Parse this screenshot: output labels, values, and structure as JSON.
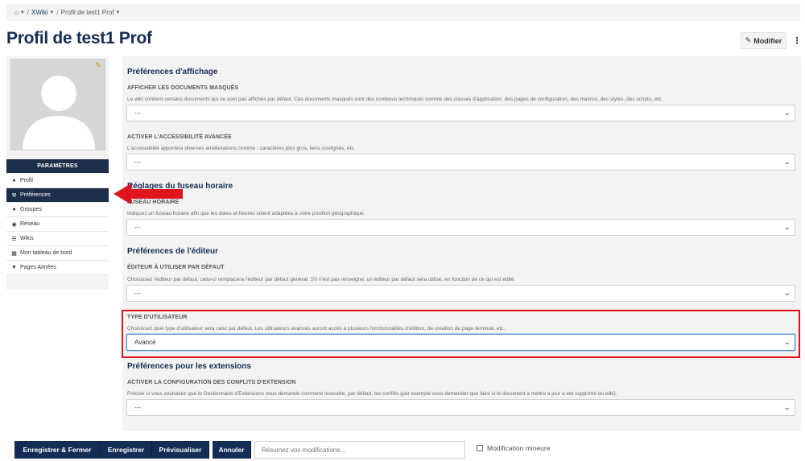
{
  "breadcrumb": {
    "home_icon": "home-icon",
    "items": [
      "XWiki",
      "Profil de test1 Prof"
    ]
  },
  "page": {
    "title": "Profil de test1 Prof",
    "edit_label": "Modifier",
    "more_icon": "more-vertical-icon"
  },
  "sidebar": {
    "settings_header": "PARAMÈTRES",
    "items": [
      {
        "label": "Profil",
        "icon": "user-icon"
      },
      {
        "label": "Préférences",
        "icon": "wrench-icon",
        "active": true
      },
      {
        "label": "Groupes",
        "icon": "users-icon"
      },
      {
        "label": "Réseau",
        "icon": "globe-icon"
      },
      {
        "label": "Wikis",
        "icon": "list-icon"
      },
      {
        "label": "Mon tableau de bord",
        "icon": "grid-icon"
      },
      {
        "label": "Pages Aimées",
        "icon": "heart-icon"
      }
    ]
  },
  "sections": {
    "display": {
      "title": "Préférences d'affichage",
      "hidden_docs": {
        "label": "AFFICHER LES DOCUMENTS MASQUÉS",
        "hint": "Le wiki contient certains documents qui ne sont pas affichés par défaut. Ces documents masqués sont des contenus techniques comme des classes d'application, des pages de configuration, des macros, des styles, des scripts, etc.",
        "value": "---"
      },
      "accessibility": {
        "label": "ACTIVER L'ACCESSIBILITÉ AVANCÉE",
        "hint": "L'accessibilité apportera diverses améliorations comme : caractères plus gros, liens soulignés, etc.",
        "value": "---"
      }
    },
    "timezone": {
      "title": "Réglages du fuseau horaire",
      "field": {
        "label": "FUSEAU HORAIRE",
        "hint": "Indiquez un fuseau horaire afin que les dates et heures soient adaptées à votre position géographique.",
        "value": "---"
      }
    },
    "editor": {
      "title": "Préférences de l'éditeur",
      "default_editor": {
        "label": "ÉDITEUR À UTILISER PAR DÉFAUT",
        "hint": "Choisissez l'éditeur par défaut, celui-ci remplacera l'éditeur par défaut général. S'il n'est pas renseigné, un éditeur par défaut sera utilisé, en fonction de ce qui est édité.",
        "value": "---"
      },
      "user_type": {
        "label": "TYPE D'UTILISATEUR",
        "hint": "Choisissez quel type d'utilisateur sera celui par défaut. Les utilisateurs avancés auront accès à plusieurs fonctionnalités d'édition, de création de page terminal, etc.",
        "value": "Avancé"
      }
    },
    "extensions": {
      "title": "Préférences pour les extensions",
      "conflicts": {
        "label": "ACTIVER LA CONFIGURATION DES CONFLITS D'EXTENSION",
        "hint": "Précise si vous souhaitez que le Gestionnaire d'Extensions vous demande comment resoudre, par défaut, les conflits (par exemple vous demander que faire si le document a mettre a jour a ete supprimé du wiki).",
        "value": "---"
      }
    }
  },
  "footer": {
    "save_close": "Enregistrer & Fermer",
    "save": "Enregistrer",
    "preview": "Prévisualiser",
    "cancel": "Annuler",
    "summary_placeholder": "Résumez vos modifications...",
    "minor_label": "Modification mineure"
  },
  "colors": {
    "navy": "#142d54",
    "highlight_red": "#e0141c"
  }
}
